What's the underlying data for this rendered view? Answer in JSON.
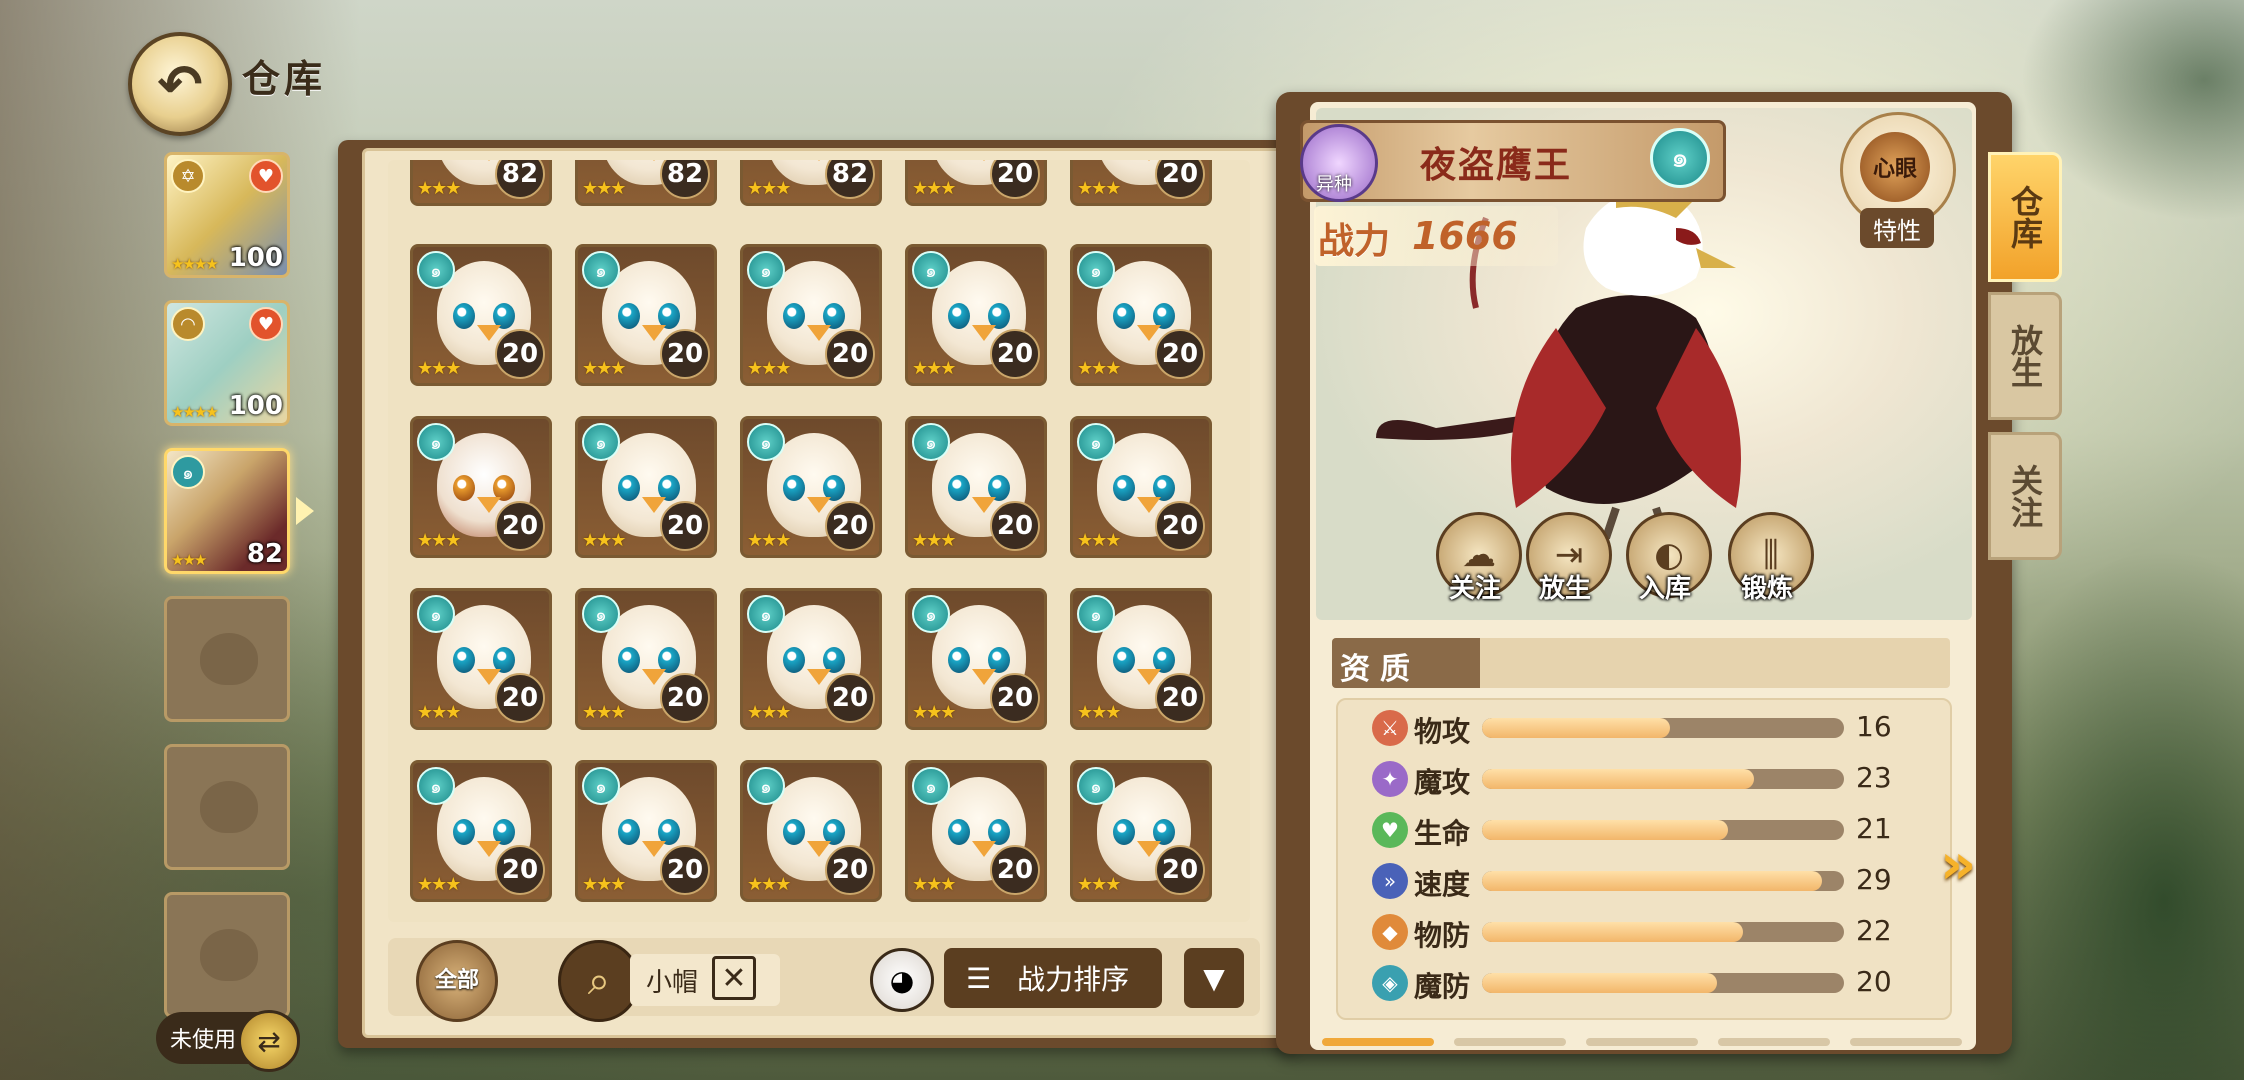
{
  "header": {
    "title": "仓库",
    "back_icon": "back-arrow-icon"
  },
  "team": {
    "slots": [
      {
        "level": "100",
        "stars": "★★★★",
        "state": "filled"
      },
      {
        "level": "100",
        "stars": "★★★★",
        "state": "filled"
      },
      {
        "level": "82",
        "stars": "★★★",
        "state": "selected"
      },
      {
        "state": "empty"
      },
      {
        "state": "empty"
      },
      {
        "state": "empty"
      }
    ],
    "unused_label": "未使用"
  },
  "grid": {
    "top_row_levels": [
      "82",
      "82",
      "82",
      "20",
      "20"
    ],
    "rows": [
      [
        "20",
        "20",
        "20",
        "20",
        "20"
      ],
      [
        "20",
        "20",
        "20",
        "20",
        "20"
      ],
      [
        "20",
        "20",
        "20",
        "20",
        "20"
      ],
      [
        "20",
        "20",
        "20",
        "20",
        "20"
      ]
    ],
    "stars": "★★★"
  },
  "toolbar": {
    "all_label": "全部",
    "search_value": "小帽",
    "clear_symbol": "✕",
    "sort_menu_symbol": "☰",
    "sort_label": "战力排序",
    "sort_dropdown_symbol": "▼"
  },
  "detail": {
    "variant_label": "异种",
    "name": "夜盗鹰王",
    "power_label": "战力",
    "power_value": "1666",
    "trait_inner": "心眼",
    "trait_label": "特性",
    "actions": [
      "关注",
      "放生",
      "入库",
      "锻炼"
    ],
    "quality_title": "资质",
    "stats": [
      {
        "name": "物攻",
        "value": "16",
        "fill": 0.52,
        "icon_color": "#d96a4a",
        "icon": "⚔"
      },
      {
        "name": "魔攻",
        "value": "23",
        "fill": 0.75,
        "icon_color": "#9a6ac8",
        "icon": "✦"
      },
      {
        "name": "生命",
        "value": "21",
        "fill": 0.68,
        "icon_color": "#5ab85a",
        "icon": "♥"
      },
      {
        "name": "速度",
        "value": "29",
        "fill": 0.94,
        "icon_color": "#4a62b8",
        "icon": "»"
      },
      {
        "name": "物防",
        "value": "22",
        "fill": 0.72,
        "icon_color": "#e08a3a",
        "icon": "◆"
      },
      {
        "name": "魔防",
        "value": "20",
        "fill": 0.65,
        "icon_color": "#3aa0b0",
        "icon": "◈"
      }
    ],
    "page_count": 5,
    "page_active": 0,
    "next_symbol": "»"
  },
  "side_tabs": [
    {
      "label": "仓库",
      "active": true
    },
    {
      "label": "放生",
      "active": false
    },
    {
      "label": "关注",
      "active": false
    }
  ]
}
